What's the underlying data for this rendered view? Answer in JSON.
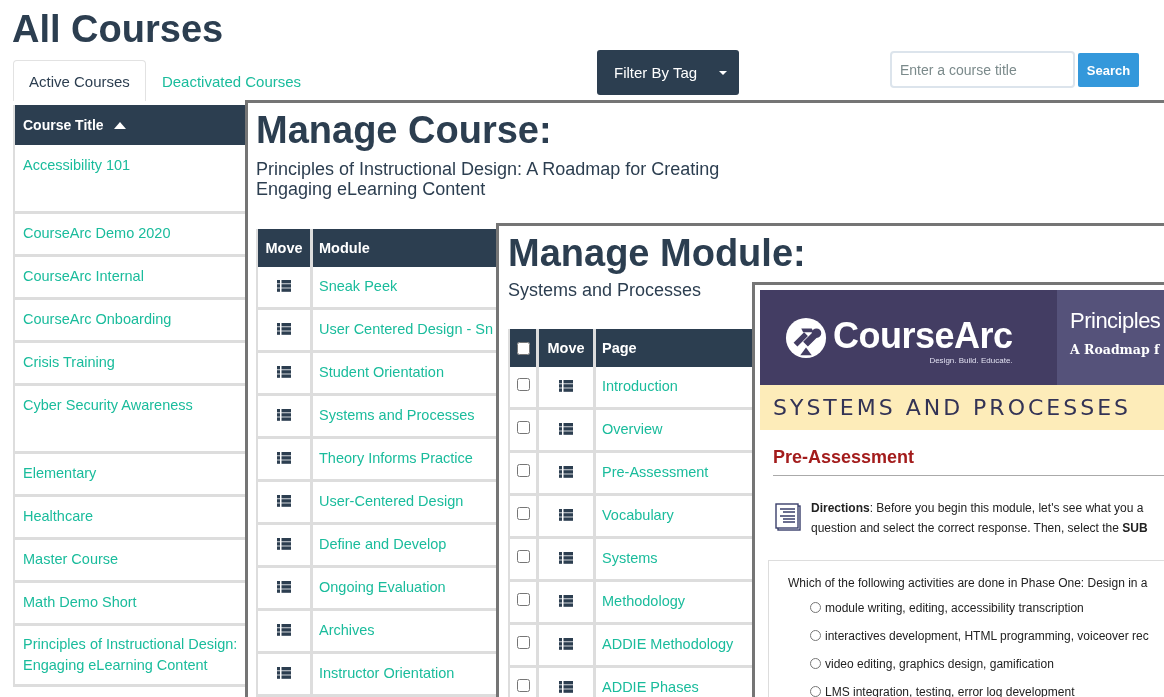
{
  "page": {
    "title": "All Courses"
  },
  "tabs": [
    {
      "label": "Active Courses",
      "selected": true
    },
    {
      "label": "Deactivated Courses",
      "selected": false
    }
  ],
  "filter_button": {
    "label": "Filter By Tag"
  },
  "search": {
    "placeholder": "Enter a course title",
    "button": "Search"
  },
  "courses_table": {
    "column": {
      "label": "Course Title",
      "sort_ascending": true
    },
    "rows": [
      "Accessibility 101",
      "CourseArc Demo 2020",
      "CourseArc Internal",
      "CourseArc Onboarding",
      "Crisis Training",
      "Cyber Security Awareness",
      "Elementary",
      "Healthcare",
      "Master Course",
      "Math Demo Short",
      "Principles of Instructional Design: Engaging eLearning Content"
    ]
  },
  "manage_course": {
    "title": "Manage Course:",
    "subtitle": "Principles of Instructional Design: A Roadmap for Creating Engaging eLearning Content",
    "columns": [
      "Move",
      "Module"
    ],
    "rows": [
      "Sneak Peek",
      "User Centered Design - Sn",
      "Student Orientation",
      "Systems and Processes",
      "Theory Informs Practice",
      "User-Centered Design",
      "Define and Develop",
      "Ongoing Evaluation",
      "Archives",
      "Instructor Orientation"
    ]
  },
  "manage_module": {
    "title": "Manage Module:",
    "subtitle": "Systems and Processes",
    "select_all_checked": false,
    "columns": [
      "Move",
      "Page"
    ],
    "rows": [
      {
        "title": "Introduction",
        "checked": false
      },
      {
        "title": "Overview",
        "checked": false
      },
      {
        "title": "Pre-Assessment",
        "checked": false
      },
      {
        "title": "Vocabulary",
        "checked": false
      },
      {
        "title": "Systems",
        "checked": false
      },
      {
        "title": "Methodology",
        "checked": false
      },
      {
        "title": "ADDIE Methodology",
        "checked": false
      },
      {
        "title": "ADDIE Phases",
        "checked": false
      }
    ]
  },
  "page_preview": {
    "logo_name": "CourseArc",
    "logo_tagline": "Design. Build. Educate.",
    "banner_title": "Principles",
    "banner_subtitle": "A Roadmap f",
    "section_title": "SYSTEMS AND PROCESSES",
    "heading": "Pre-Assessment",
    "directions": [
      "**Directions**: Before you begin this module, let's see what you a",
      "question and select the correct response. Then, select the **SUB**"
    ],
    "question": "Which of the following activities are done in Phase One: Design in a",
    "options": [
      {
        "label": "module writing, editing, accessibility transcription",
        "selected": false
      },
      {
        "label": "interactives development, HTML programming, voiceover rec",
        "selected": false
      },
      {
        "label": "video editing, graphics design, gamification",
        "selected": false
      },
      {
        "label": "LMS integration, testing, error log development",
        "selected": false
      }
    ]
  }
}
